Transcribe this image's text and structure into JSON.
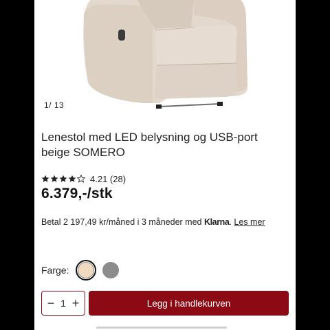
{
  "gallery": {
    "counter": "1/ 13"
  },
  "product": {
    "title": "Lenestol med LED belysning og USB-port beige SOMERO",
    "rating_value": 4.21,
    "rating_text": "4.21 (28)",
    "stars_filled": 4,
    "stars_total": 5,
    "price": "6.379,-/stk"
  },
  "installment": {
    "prefix": "Betal 2 197,49 kr/måned i 3 måneder med ",
    "provider": "Klarna",
    "suffix": ". ",
    "link": "Les mer"
  },
  "color_picker": {
    "label": "Farge:",
    "options": [
      {
        "name": "beige-swatch",
        "color": "#efd9bf",
        "selected": true
      },
      {
        "name": "grey-swatch",
        "color": "#8c8c8c",
        "selected": false
      }
    ]
  },
  "quantity": {
    "minus": "−",
    "value": "1",
    "plus": "+"
  },
  "cart": {
    "button_label": "Legg i handlekurven",
    "accent_color": "#8b0a14"
  }
}
